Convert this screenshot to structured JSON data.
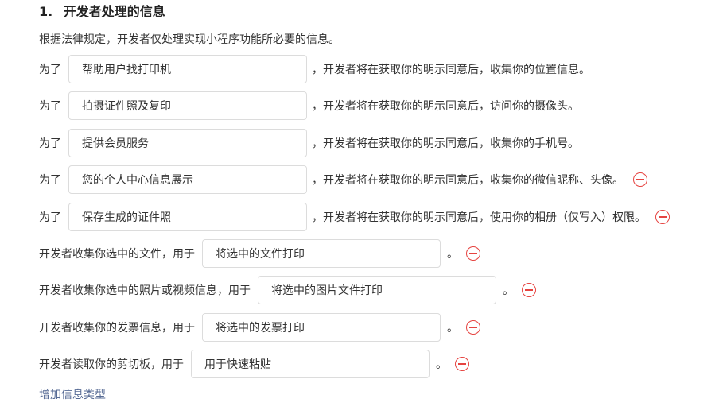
{
  "section": {
    "number": "1.",
    "title": "开发者处理的信息"
  },
  "intro": "根据法律规定，开发者仅处理实现小程序功能所必要的信息。",
  "rows": [
    {
      "prefix": "为了",
      "purpose": "帮助用户找打印机",
      "suffix": "，开发者将在获取你的明示同意后，收集你的位置信息。",
      "removable": false
    },
    {
      "prefix": "为了",
      "purpose": "拍摄证件照及复印",
      "suffix": "，开发者将在获取你的明示同意后，访问你的摄像头。",
      "removable": false
    },
    {
      "prefix": "为了",
      "purpose": "提供会员服务",
      "suffix": "，开发者将在获取你的明示同意后，收集你的手机号。",
      "removable": false
    },
    {
      "prefix": "为了",
      "purpose": "您的个人中心信息展示",
      "suffix": "，开发者将在获取你的明示同意后，收集你的微信昵称、头像。",
      "removable": true
    },
    {
      "prefix": "为了",
      "purpose": "保存生成的证件照",
      "suffix": "，开发者将在获取你的明示同意后，使用你的相册（仅写入）权限。",
      "removable": true
    },
    {
      "prefix": "开发者收集你选中的文件，用于",
      "purpose": "将选中的文件打印",
      "suffix": "。",
      "removable": true
    },
    {
      "prefix": "开发者收集你选中的照片或视频信息，用于",
      "purpose": "将选中的图片文件打印",
      "suffix": "。",
      "removable": true
    },
    {
      "prefix": "开发者收集你的发票信息，用于",
      "purpose": "将选中的发票打印",
      "suffix": "。",
      "removable": true
    },
    {
      "prefix": "开发者读取你的剪切板，用于",
      "purpose": "用于快速粘贴",
      "suffix": "。",
      "removable": true
    }
  ],
  "add_link": "增加信息类型",
  "colors": {
    "remove_icon": "#e64340",
    "link": "#576b95",
    "border": "#dcdcdc"
  }
}
